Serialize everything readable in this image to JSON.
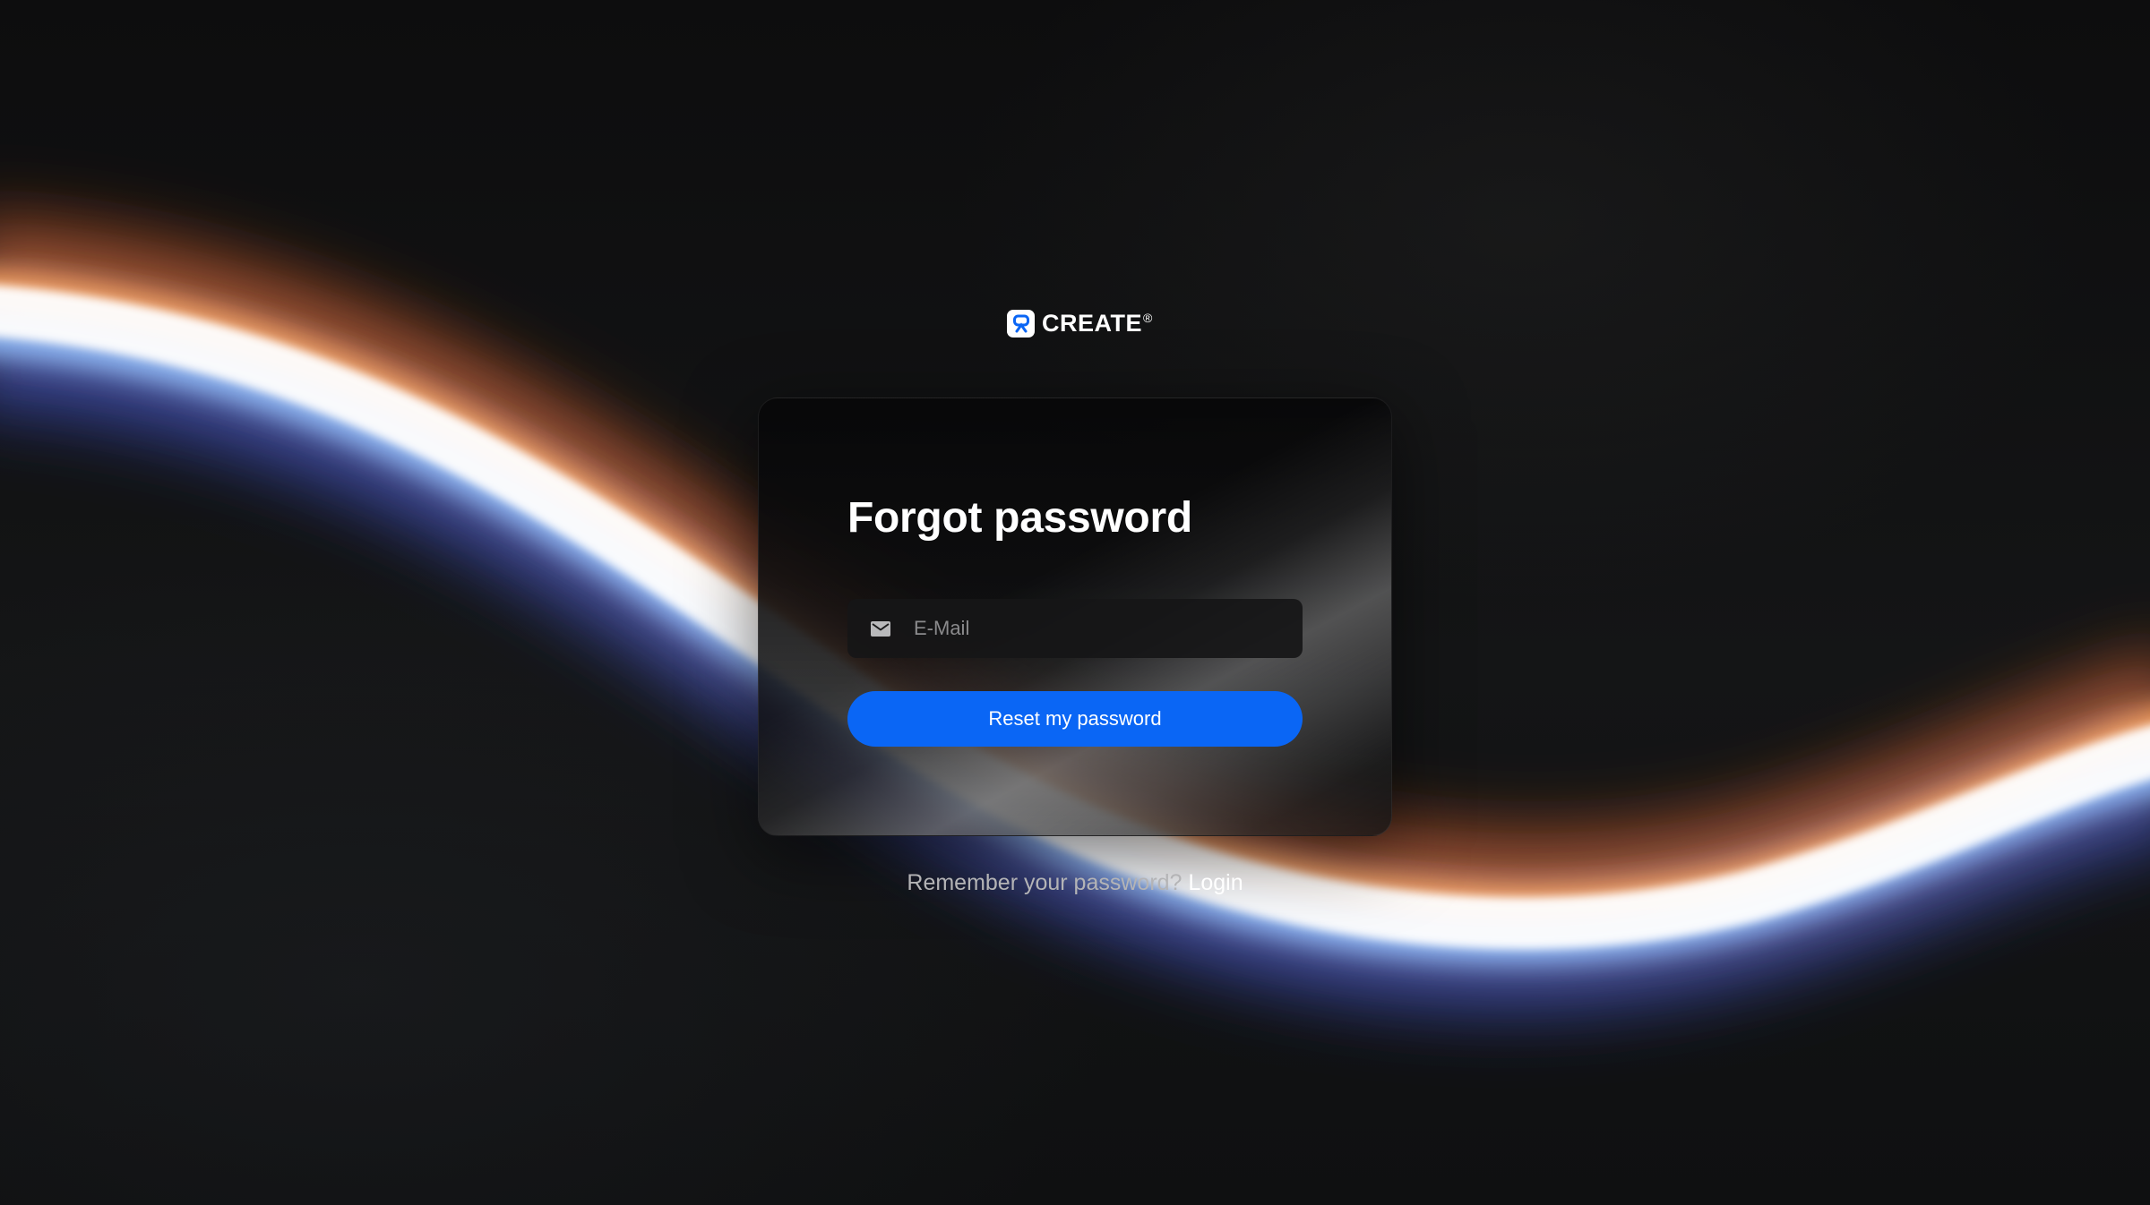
{
  "brand": {
    "name": "CREATE",
    "mark": "®",
    "logo_icon": "create-logo-icon"
  },
  "card": {
    "title": "Forgot password",
    "email": {
      "icon": "envelope-icon",
      "placeholder": "E-Mail",
      "value": ""
    },
    "submit_label": "Reset my password"
  },
  "footer": {
    "prompt": "Remember your password?",
    "login_label": "Login"
  },
  "colors": {
    "background": "#0b0b0c",
    "card": "#0c0c0d",
    "accent": "#0a66f5",
    "text": "#ffffff",
    "muted": "#b4b4b6"
  }
}
